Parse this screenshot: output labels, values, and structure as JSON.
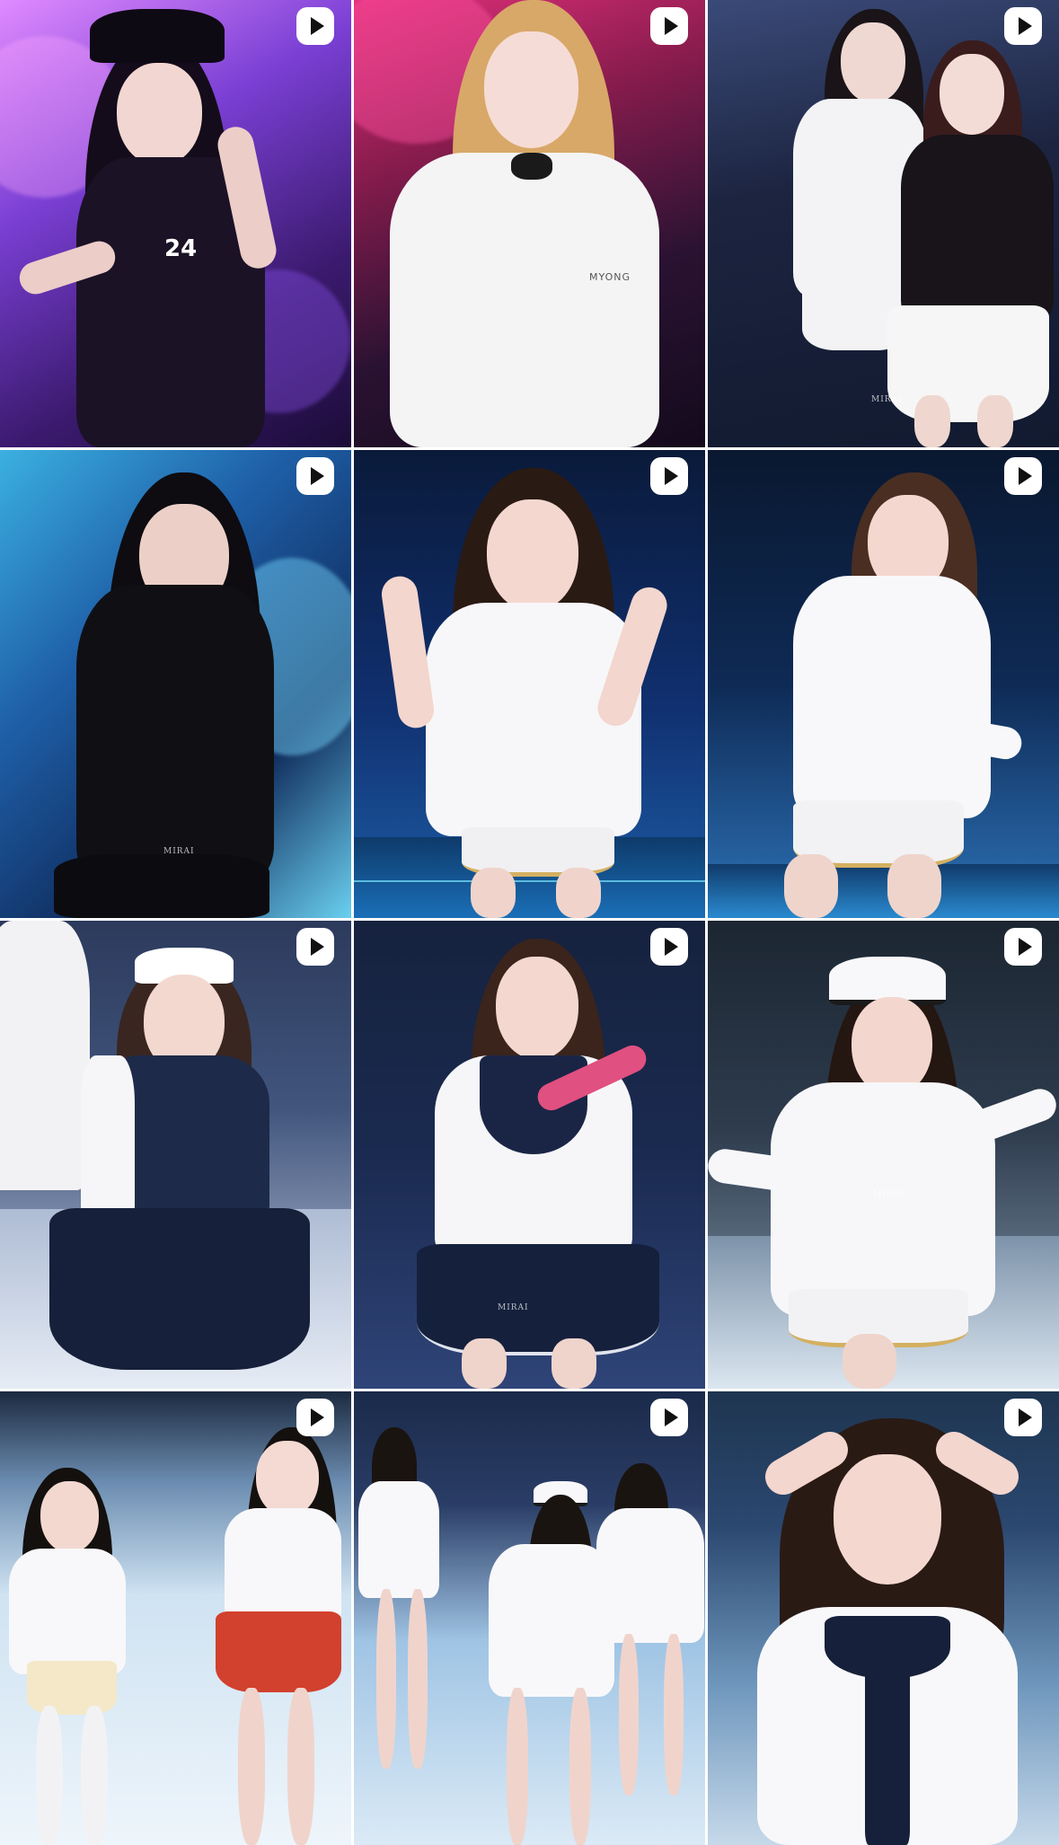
{
  "feed": {
    "badge_icon": "reel-play-icon",
    "badge_color": "#ffffff",
    "tiles": [
      {
        "id": "post-1",
        "outfit": "black jersey",
        "jersey_number": "24",
        "palette": {
          "bg1": "#3b1a6e",
          "bg2": "#b27bf0",
          "accent": "#6d2fd0"
        }
      },
      {
        "id": "post-2",
        "outfit": "white jacket",
        "chest_text": "MYONG",
        "palette": {
          "bg1": "#2a1232",
          "bg2": "#c2185b",
          "accent": "#5d1a3a"
        }
      },
      {
        "id": "post-3",
        "outfit": "white & black duo",
        "watermark": "MIRAI",
        "palette": {
          "bg1": "#121a30",
          "bg2": "#34406a",
          "accent": "#1c2440"
        }
      },
      {
        "id": "post-4",
        "outfit": "black halter",
        "watermark": "MIRAI",
        "palette": {
          "bg1": "#0f2a5a",
          "bg2": "#3bb0e0",
          "accent": "#1e5fa8"
        }
      },
      {
        "id": "post-5",
        "outfit": "white captain uniform",
        "palette": {
          "bg1": "#0a1a3a",
          "bg2": "#1e5fa8",
          "accent": "#103070"
        }
      },
      {
        "id": "post-6",
        "outfit": "white captain uniform",
        "palette": {
          "bg1": "#0a1830",
          "bg2": "#2d73b8",
          "accent": "#0e2a55"
        }
      },
      {
        "id": "post-7",
        "outfit": "navy sailor dress",
        "palette": {
          "bg1": "#2c3a5c",
          "bg2": "#cdd7e8",
          "accent": "#41557d"
        }
      },
      {
        "id": "post-8",
        "outfit": "sailor top & navy skirt",
        "watermark": "MIRAI",
        "palette": {
          "bg1": "#1a2a50",
          "bg2": "#2f4478",
          "accent": "#16223e"
        }
      },
      {
        "id": "post-9",
        "outfit": "white captain uniform with hat",
        "watermark": "MIRAI",
        "palette": {
          "bg1": "#1c2632",
          "bg2": "#8fa3b8",
          "accent": "#2e3c4e"
        }
      },
      {
        "id": "post-10",
        "outfit": "casual tees",
        "palette": {
          "bg1": "#cfe3f2",
          "bg2": "#eef5fb",
          "accent": "#1c2a40"
        }
      },
      {
        "id": "post-11",
        "outfit": "group in white uniforms",
        "palette": {
          "bg1": "#1a2a4a",
          "bg2": "#9fc4e4",
          "accent": "#2a3d66"
        }
      },
      {
        "id": "post-12",
        "outfit": "sailor top with bow",
        "palette": {
          "bg1": "#1e3550",
          "bg2": "#6f97bd",
          "accent": "#2b4870"
        }
      }
    ]
  }
}
